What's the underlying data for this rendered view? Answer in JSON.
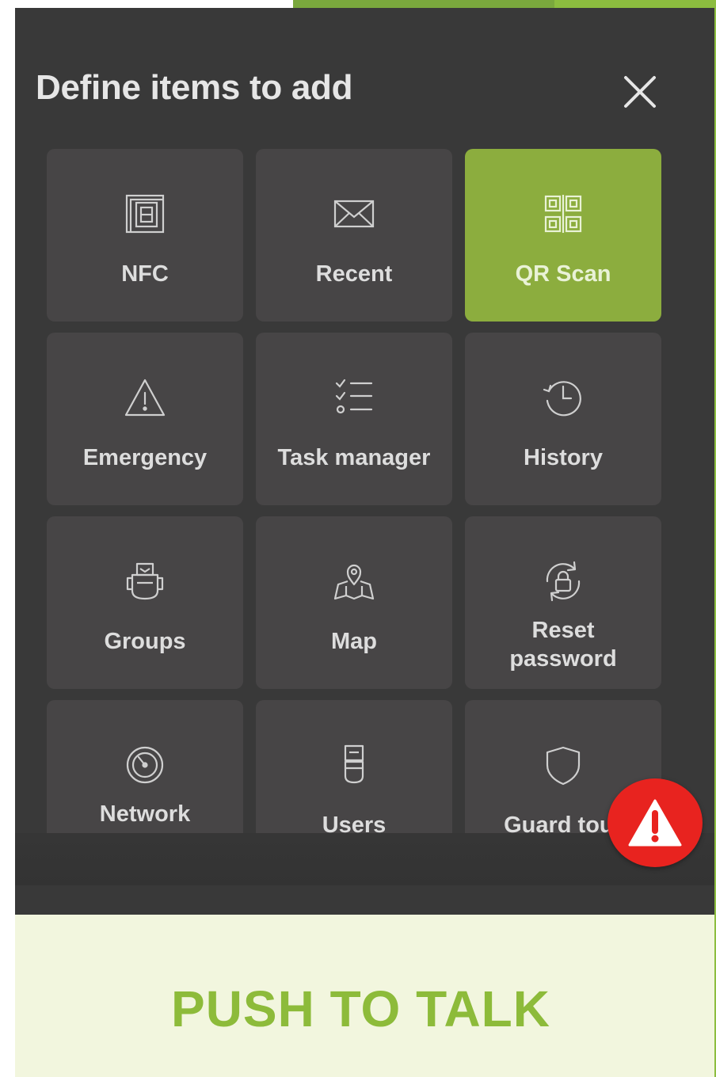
{
  "dialog": {
    "title": "Define items to add",
    "close_icon": "close-icon"
  },
  "tiles": [
    {
      "label": "NFC",
      "icon": "nfc-icon",
      "selected": false
    },
    {
      "label": "Recent",
      "icon": "envelope-icon",
      "selected": false
    },
    {
      "label": "QR Scan",
      "icon": "qr-code-icon",
      "selected": true
    },
    {
      "label": "Emergency",
      "icon": "warning-icon",
      "selected": false
    },
    {
      "label": "Task manager",
      "icon": "checklist-icon",
      "selected": false
    },
    {
      "label": "History",
      "icon": "history-icon",
      "selected": false
    },
    {
      "label": "Groups",
      "icon": "groups-icon",
      "selected": false
    },
    {
      "label": "Map",
      "icon": "map-icon",
      "selected": false
    },
    {
      "label": "Reset password",
      "icon": "lock-reset-icon",
      "selected": false
    },
    {
      "label": "Network",
      "icon": "network-gauge-icon",
      "selected": false
    },
    {
      "label": "Users",
      "icon": "users-icon",
      "selected": false
    },
    {
      "label": "Guard tour",
      "icon": "shield-icon",
      "selected": false
    }
  ],
  "sos_button": {
    "icon": "alert-triangle-icon"
  },
  "push_to_talk": {
    "label": "PUSH TO TALK"
  },
  "colors": {
    "accent": "#8cad3e",
    "dialog_bg": "#393939",
    "tile_bg": "#474546",
    "sos": "#e8231f",
    "ptt_text": "#8dbb3a",
    "ptt_bg": "#f2f6de"
  }
}
